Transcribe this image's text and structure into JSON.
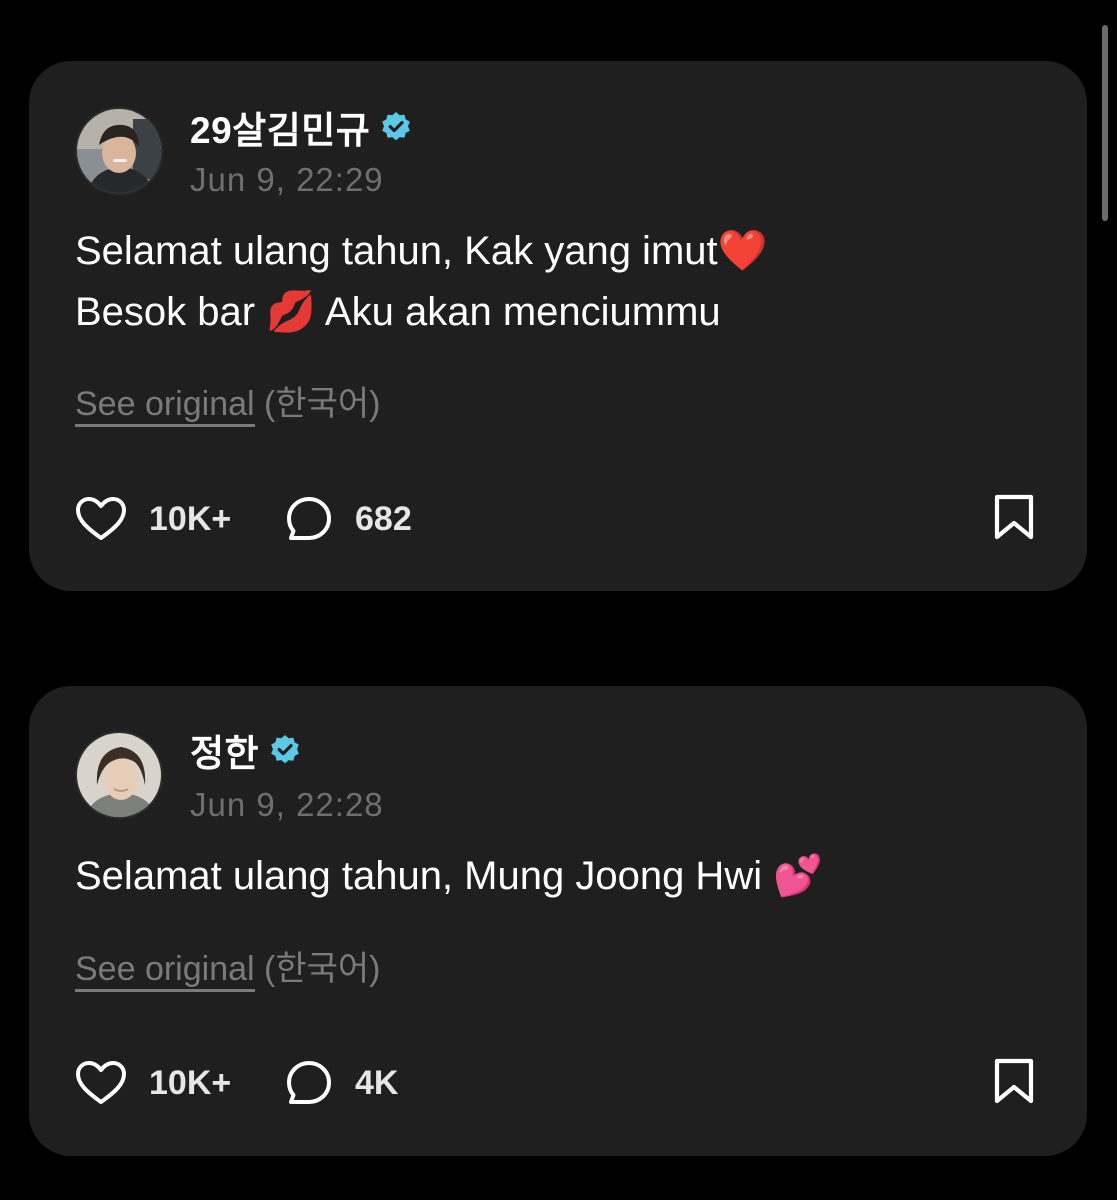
{
  "colors": {
    "background": "#000000",
    "card": "#1f1f20",
    "verified_badge": "#5bc8e6",
    "muted_text": "#7a7a7a"
  },
  "posts": [
    {
      "username": "29살김민규",
      "verified": true,
      "timestamp": "Jun 9, 22:29",
      "lines": [
        "Selamat ulang tahun, Kak yang imut❤️",
        "Besok bar 💋  Aku akan menciummu"
      ],
      "see_original_label": "See original",
      "original_language": "(한국어)",
      "likes": "10K+",
      "comments": "682",
      "icons": [
        "avatar-photo",
        "verified-badge-icon",
        "heart-icon",
        "comment-icon",
        "bookmark-icon"
      ]
    },
    {
      "username": "정한",
      "verified": true,
      "timestamp": "Jun 9, 22:28",
      "lines": [
        "Selamat ulang tahun, Mung Joong Hwi 💕"
      ],
      "see_original_label": "See original",
      "original_language": "(한국어)",
      "likes": "10K+",
      "comments": "4K",
      "icons": [
        "avatar-photo",
        "verified-badge-icon",
        "heart-icon",
        "comment-icon",
        "bookmark-icon"
      ]
    }
  ]
}
